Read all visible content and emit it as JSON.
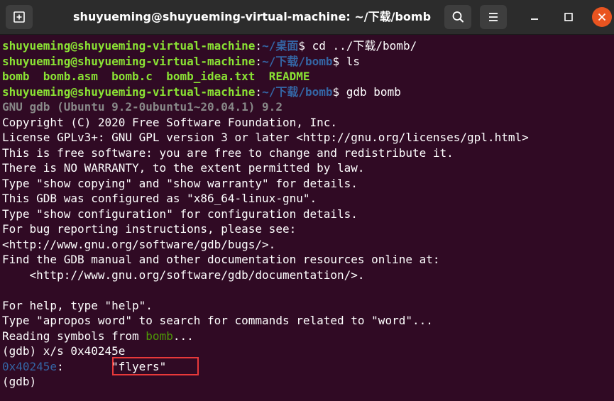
{
  "window": {
    "title": "shuyueming@shuyueming-virtual-machine: ~/下载/bomb"
  },
  "colors": {
    "background": "#300a24",
    "prompt_user": "#8ae234",
    "prompt_path": "#3465a4",
    "close_button": "#e95420",
    "highlight_box": "#e8393a"
  },
  "icons": {
    "new_tab": "new-tab-icon",
    "search": "search-icon",
    "menu": "hamburger-menu-icon",
    "minimize": "minimize-icon",
    "maximize": "maximize-icon",
    "close": "close-icon"
  },
  "terminal": {
    "line1": {
      "user": "shuyueming@shuyueming-virtual-machine",
      "sep": ":",
      "path": "~/桌面",
      "cmd": "$ cd ../下载/bomb/"
    },
    "line2": {
      "user": "shuyueming@shuyueming-virtual-machine",
      "sep": ":",
      "path": "~/下载/bomb",
      "cmd": "$ ls"
    },
    "line3": {
      "files": [
        "bomb",
        "bomb.asm",
        "bomb.c",
        "bomb_idea.txt",
        "README"
      ]
    },
    "line4": {
      "user": "shuyueming@shuyueming-virtual-machine",
      "sep": ":",
      "path": "~/下载/bomb",
      "cmd": "$ gdb bomb"
    },
    "line5": "GNU gdb (Ubuntu 9.2-0ubuntu1~20.04.1) 9.2",
    "line6": "Copyright (C) 2020 Free Software Foundation, Inc.",
    "line7": "License GPLv3+: GNU GPL version 3 or later <http://gnu.org/licenses/gpl.html>",
    "line8": "This is free software: you are free to change and redistribute it.",
    "line9": "There is NO WARRANTY, to the extent permitted by law.",
    "line10": "Type \"show copying\" and \"show warranty\" for details.",
    "line11": "This GDB was configured as \"x86_64-linux-gnu\".",
    "line12": "Type \"show configuration\" for configuration details.",
    "line13": "For bug reporting instructions, please see:",
    "line14": "<http://www.gnu.org/software/gdb/bugs/>.",
    "line15": "Find the GDB manual and other documentation resources online at:",
    "line16": "    <http://www.gnu.org/software/gdb/documentation/>.",
    "line18": "For help, type \"help\".",
    "line19": "Type \"apropos word\" to search for commands related to \"word\"...",
    "line20": {
      "pre": "Reading symbols from ",
      "file": "bomb",
      "post": "..."
    },
    "line21": "(gdb) x/s 0x40245e",
    "line22": {
      "addr": "0x40245e",
      "sep": ":",
      "value": "\"flyers\""
    },
    "line23": "(gdb)"
  }
}
